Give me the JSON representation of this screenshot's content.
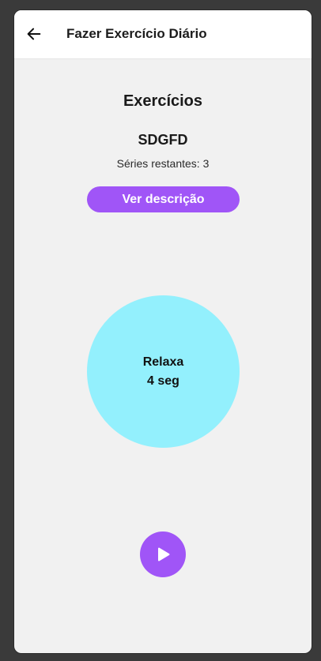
{
  "header": {
    "title": "Fazer Exercício Diário",
    "back_icon": "arrow-left-icon"
  },
  "main": {
    "section_title": "Exercícios",
    "exercise_name": "SDGFD",
    "series_text": "Séries restantes: 3",
    "description_button": "Ver descrição",
    "timer": {
      "state": "Relaxa",
      "time": "4 seg"
    },
    "play_icon": "play-icon"
  },
  "colors": {
    "accent": "#a055f7",
    "timer_circle": "#93f0fd",
    "background": "#f1f1f1",
    "appbar": "#ffffff"
  }
}
